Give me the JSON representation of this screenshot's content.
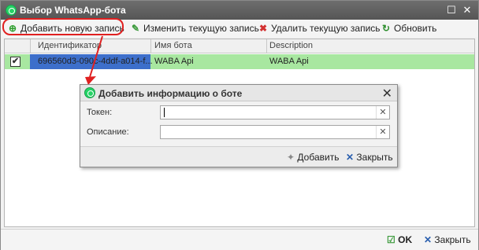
{
  "window": {
    "title": "Выбор WhatsApp-бота"
  },
  "toolbar": {
    "add": "Добавить новую запись",
    "edit": "Изменить текущую запись",
    "delete": "Удалить текущую запись",
    "refresh": "Обновить"
  },
  "grid": {
    "columns": [
      "Идентификатор",
      "Имя бота",
      "Description"
    ],
    "rows": [
      {
        "id": "696560d3-090c-4ddf-a014-f...",
        "name": "WABA Api",
        "description": "WABA Api",
        "checked": "✔"
      }
    ]
  },
  "dialog": {
    "title": "Добавить информацию о боте",
    "token_label": "Токен:",
    "token_value": "",
    "desc_label": "Описание:",
    "desc_value": "",
    "add_button": "Добавить",
    "close_button": "Закрыть"
  },
  "bottom": {
    "ok": "OK",
    "close": "Закрыть"
  },
  "colors": {
    "selected_row": "#a8e7a0",
    "highlight": "#e02020",
    "whatsapp": "#25d366"
  }
}
